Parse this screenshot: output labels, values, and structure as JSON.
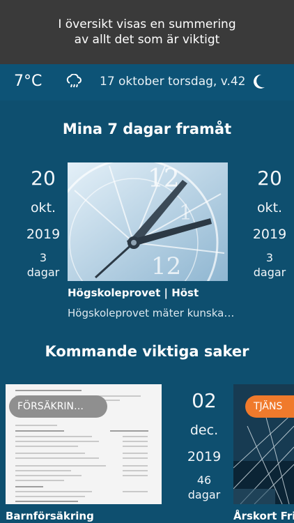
{
  "caption": {
    "line1": "I översikt visas en summering",
    "line2": "av allt det som är viktigt"
  },
  "statusbar": {
    "temperature": "7°C",
    "weather_icon": "cloud-rain-icon",
    "date_text": "17 oktober torsdag, v.42",
    "mode_icon": "moon-icon"
  },
  "week_section": {
    "title": "Mina 7 dagar framåt",
    "left_date": {
      "day": "20",
      "month": "okt.",
      "year": "2019",
      "count": "3",
      "unit": "dagar"
    },
    "right_date": {
      "day": "20",
      "month": "okt.",
      "year": "2019",
      "count": "3",
      "unit": "dagar"
    },
    "card": {
      "title": "Högskoleprovet | Höst",
      "description": "Högskoleprovet mäter kunska…"
    }
  },
  "important_section": {
    "title": "Kommande viktiga saker",
    "left_card": {
      "tag": "FÖRSÄKRIN…",
      "title": "Barnförsäkring"
    },
    "center_date": {
      "day": "02",
      "month": "dec.",
      "year": "2019",
      "count": "46",
      "unit": "dagar"
    },
    "right_card": {
      "tag": "TJÄNS",
      "title": "Årskort Frisk"
    }
  },
  "colors": {
    "background": "#0e4f6f",
    "statusbar": "#0d5376",
    "caption_bg": "#3a3a3a",
    "tag_orange": "#f07a2c",
    "tag_grey": "#8f8f8f"
  }
}
